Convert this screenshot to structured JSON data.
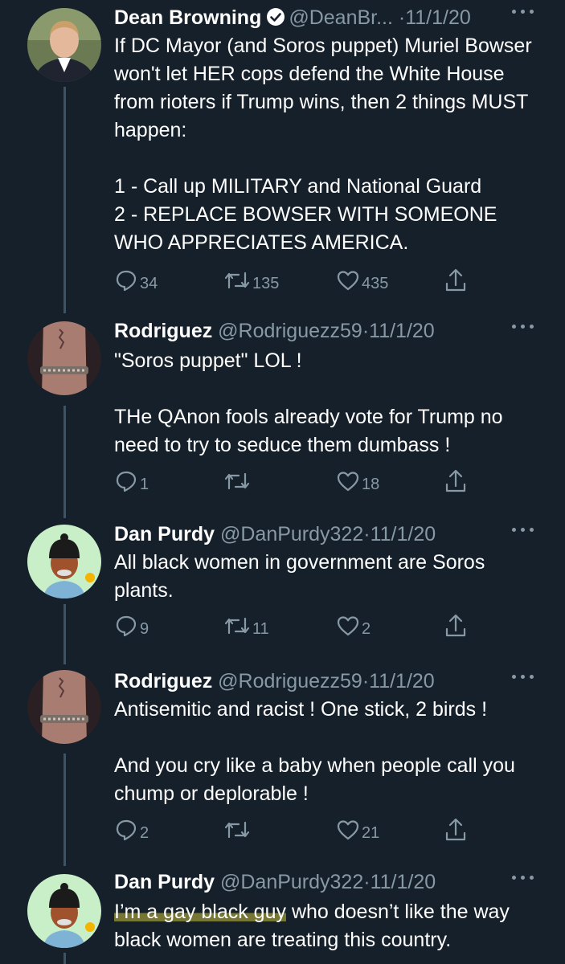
{
  "tweets": [
    {
      "name": "Dean Browning",
      "verified": true,
      "handle": "@DeanBr...",
      "separator": "·",
      "date": "11/1/20",
      "text": "If DC Mayor (and Soros puppet) Muriel Bowser won't let HER cops defend the White House from rioters if Trump wins, then 2 things MUST happen:\n\n1 - Call up MILITARY and National Guard\n2 - REPLACE BOWSER WITH SOMEONE WHO APPRECIATES AMERICA.",
      "replies": "34",
      "retweets": "135",
      "likes": "435"
    },
    {
      "name": "Rodriguez",
      "handle": "@Rodriguezz59",
      "separator": "·",
      "date": "11/1/20",
      "text": "\"Soros puppet\" LOL !\n\nTHe QAnon fools already vote for Trump no need to try to seduce them dumbass !",
      "replies": "1",
      "retweets": "",
      "likes": "18"
    },
    {
      "name": "Dan Purdy",
      "handle": "@DanPurdy322",
      "separator": "·",
      "date": "11/1/20",
      "text": "All black women in government are Soros plants.",
      "replies": "9",
      "retweets": "11",
      "likes": "2"
    },
    {
      "name": "Rodriguez",
      "handle": "@Rodriguezz59",
      "separator": "·",
      "date": "11/1/20",
      "text": "Antisemitic and racist ! One stick, 2 birds !\n\nAnd you cry like a baby when people call you chump or deplorable !",
      "replies": "2",
      "retweets": "",
      "likes": "21"
    },
    {
      "name": "Dan Purdy",
      "handle": "@DanPurdy322",
      "separator": "·",
      "date": "11/1/20",
      "text_highlighted": "I’m a gay black guy",
      "text_rest": " who doesn’t like the way black women are treating this country."
    }
  ],
  "colors": {
    "background": "#15202b",
    "secondary_text": "#8899a6",
    "verified": "#ffffff",
    "highlight": "#c8be3c"
  }
}
